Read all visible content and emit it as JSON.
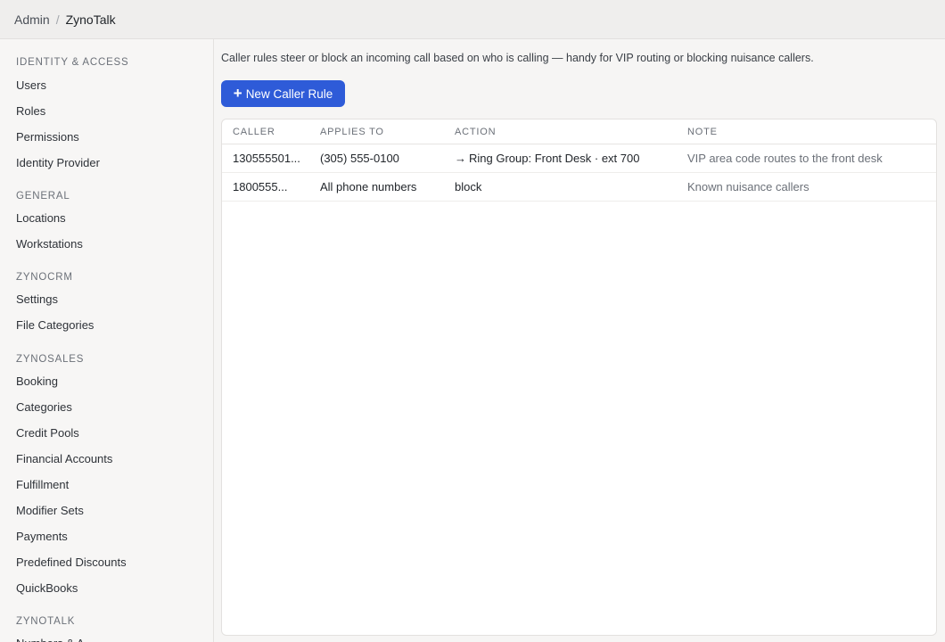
{
  "breadcrumb": {
    "root": "Admin",
    "separator": "/",
    "current": "ZynoTalk"
  },
  "sidebar": {
    "sections": [
      {
        "title": "IDENTITY & ACCESS",
        "items": [
          "Users",
          "Roles",
          "Permissions",
          "Identity Provider"
        ]
      },
      {
        "title": "GENERAL",
        "items": [
          "Locations",
          "Workstations"
        ]
      },
      {
        "title": "ZYNOCRM",
        "items": [
          "Settings",
          "File Categories"
        ]
      },
      {
        "title": "ZYNOSALES",
        "items": [
          "Booking",
          "Categories",
          "Credit Pools",
          "Financial Accounts",
          "Fulfillment",
          "Modifier Sets",
          "Payments",
          "Predefined Discounts",
          "QuickBooks"
        ]
      },
      {
        "title": "ZYNOTALK",
        "items": [
          "Numbers & A..."
        ]
      }
    ]
  },
  "main": {
    "description": "Caller rules steer or block an incoming call based on who is calling — handy for VIP routing or blocking nuisance callers.",
    "new_button_label": "New Caller Rule",
    "new_button_icon": "plus-icon",
    "table": {
      "headers": {
        "caller": "CALLER",
        "applies_to": "APPLIES TO",
        "action": "ACTION",
        "note": "NOTE"
      },
      "rows": [
        {
          "caller": "130555501...",
          "applies_to": "(305) 555-0100",
          "action_arrow": "→",
          "action": "Ring Group: Front Desk · ext 700",
          "note": "VIP area code routes to the front desk"
        },
        {
          "caller": "1800555...",
          "applies_to": "All phone numbers",
          "action_arrow": "",
          "action": "block",
          "note": "Known nuisance callers"
        }
      ]
    }
  },
  "colors": {
    "accent": "#2e5bd8",
    "background": "#f6f5f4",
    "card": "#ffffff"
  }
}
